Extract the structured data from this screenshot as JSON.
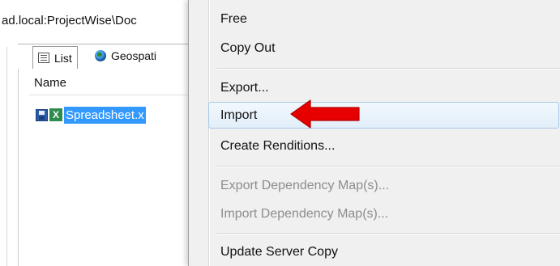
{
  "background_window": {
    "path": "ad.local:ProjectWise\\Doc",
    "tabs": [
      {
        "label": "List",
        "icon": "list-icon"
      },
      {
        "label": "Geospati",
        "icon": "globe-icon"
      }
    ],
    "column_header": "Name",
    "file": {
      "name": "Spreadsheet.x",
      "icons": [
        "save-icon",
        "excel-icon"
      ],
      "excel_letter": "X"
    }
  },
  "context_menu": {
    "items": [
      {
        "label": "Free",
        "enabled": true
      },
      {
        "label": "Copy Out",
        "enabled": true
      },
      {
        "label": "Export...",
        "enabled": true
      },
      {
        "label": "Import",
        "enabled": true,
        "highlighted": true
      },
      {
        "label": "Create Renditions...",
        "enabled": true
      },
      {
        "label": "Export Dependency Map(s)...",
        "enabled": false
      },
      {
        "label": "Import Dependency Map(s)...",
        "enabled": false
      },
      {
        "label": "Update Server Copy",
        "enabled": true
      }
    ]
  },
  "colors": {
    "selection_blue": "#3399ff",
    "menu_bg": "#f0f0f0",
    "highlight_border": "#a8c8e8",
    "annotation_arrow": "#e60000",
    "disabled_text": "#8d8d8d"
  }
}
